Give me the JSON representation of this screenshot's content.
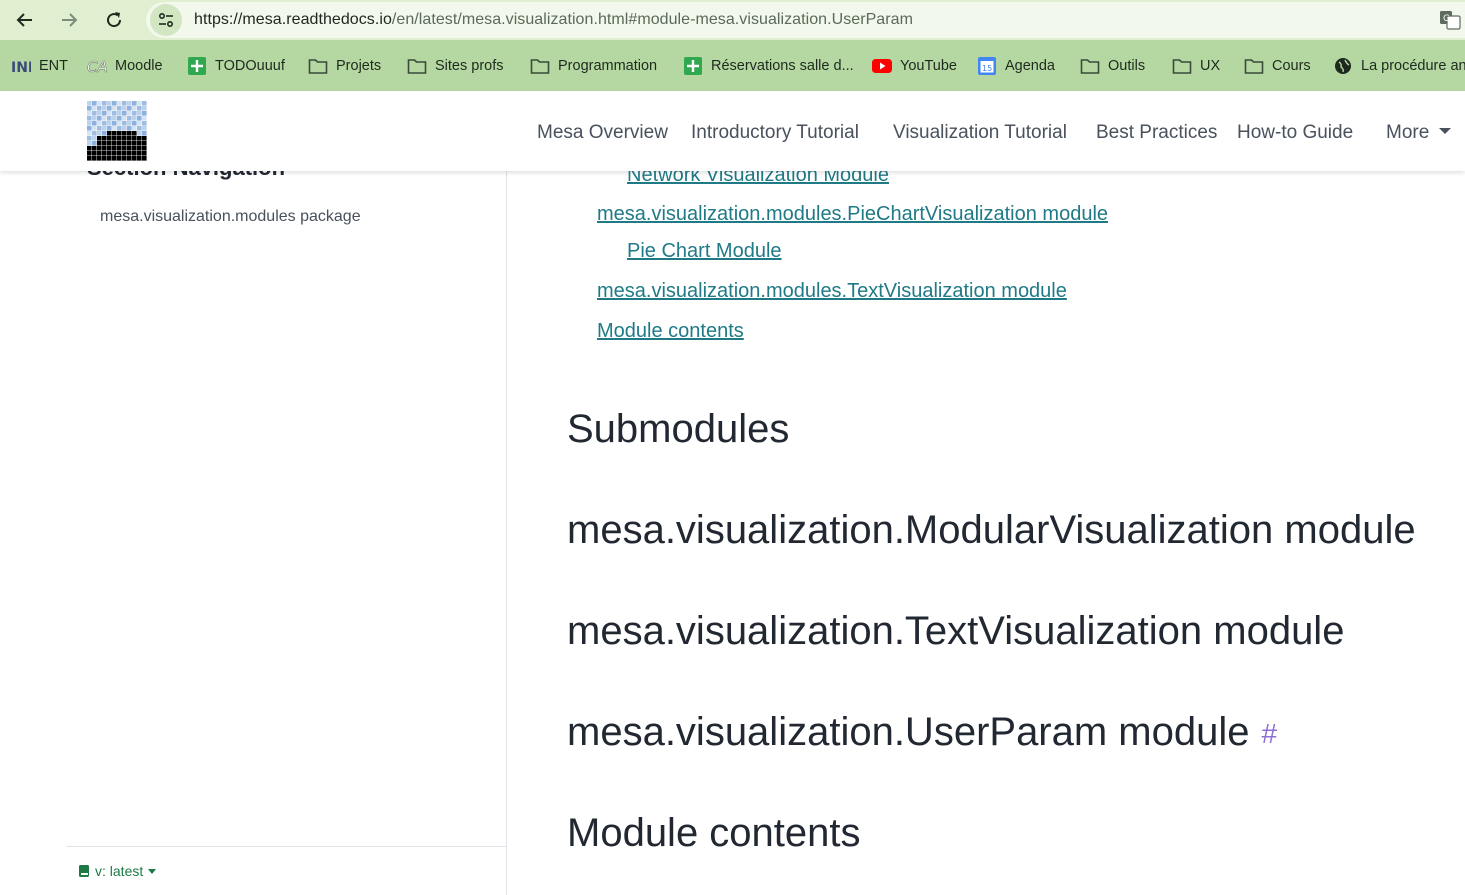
{
  "browser": {
    "url_host": "https://mesa.readthedocs.io",
    "url_path": "/en/latest/mesa.visualization.html#module-mesa.visualization.UserParam",
    "bookmarks": [
      {
        "label": "ENT",
        "icon": "ent-icon"
      },
      {
        "label": "Moodle",
        "icon": "moodle-icon"
      },
      {
        "label": "TODOuuuf",
        "icon": "plus-square-icon"
      },
      {
        "label": "Projets",
        "icon": "folder-icon"
      },
      {
        "label": "Sites profs",
        "icon": "folder-icon"
      },
      {
        "label": "Programmation",
        "icon": "folder-icon"
      },
      {
        "label": "Réservations salle d...",
        "icon": "plus-square-icon"
      },
      {
        "label": "YouTube",
        "icon": "youtube-icon"
      },
      {
        "label": "Agenda",
        "icon": "calendar-icon"
      },
      {
        "label": "Outils",
        "icon": "folder-icon"
      },
      {
        "label": "UX",
        "icon": "folder-icon"
      },
      {
        "label": "Cours",
        "icon": "folder-icon"
      },
      {
        "label": "La procédure an",
        "icon": "globe-icon"
      }
    ],
    "calendar_day": "15"
  },
  "navbar": {
    "links": [
      "Mesa Overview",
      "Introductory Tutorial",
      "Visualization Tutorial",
      "Best Practices",
      "How-to Guide"
    ],
    "more_label": "More"
  },
  "sidebar": {
    "section_title": "Section Navigation",
    "items": [
      "mesa.visualization.modules package"
    ],
    "version_label": "v: latest"
  },
  "main": {
    "toc": [
      {
        "label": "Network Visualization Module",
        "level": 2
      },
      {
        "label": "mesa.visualization.modules.PieChartVisualization module",
        "level": 1
      },
      {
        "label": "Pie Chart Module",
        "level": 2
      },
      {
        "label": "mesa.visualization.modules.TextVisualization module",
        "level": 1
      },
      {
        "label": "Module contents",
        "level": 1
      }
    ],
    "headings": [
      {
        "text": "Submodules"
      },
      {
        "text": "mesa.visualization.ModularVisualization module"
      },
      {
        "text": "mesa.visualization.TextVisualization module"
      },
      {
        "text": "mesa.visualization.UserParam module",
        "anchor": "#"
      },
      {
        "text": "Module contents"
      }
    ]
  },
  "colors": {
    "toolbar": "#dfefcf",
    "bookmarks_bar": "#b5d8a2",
    "link": "#1f7a86",
    "headerlink": "#8e6fd3",
    "version": "#1d7a45"
  }
}
